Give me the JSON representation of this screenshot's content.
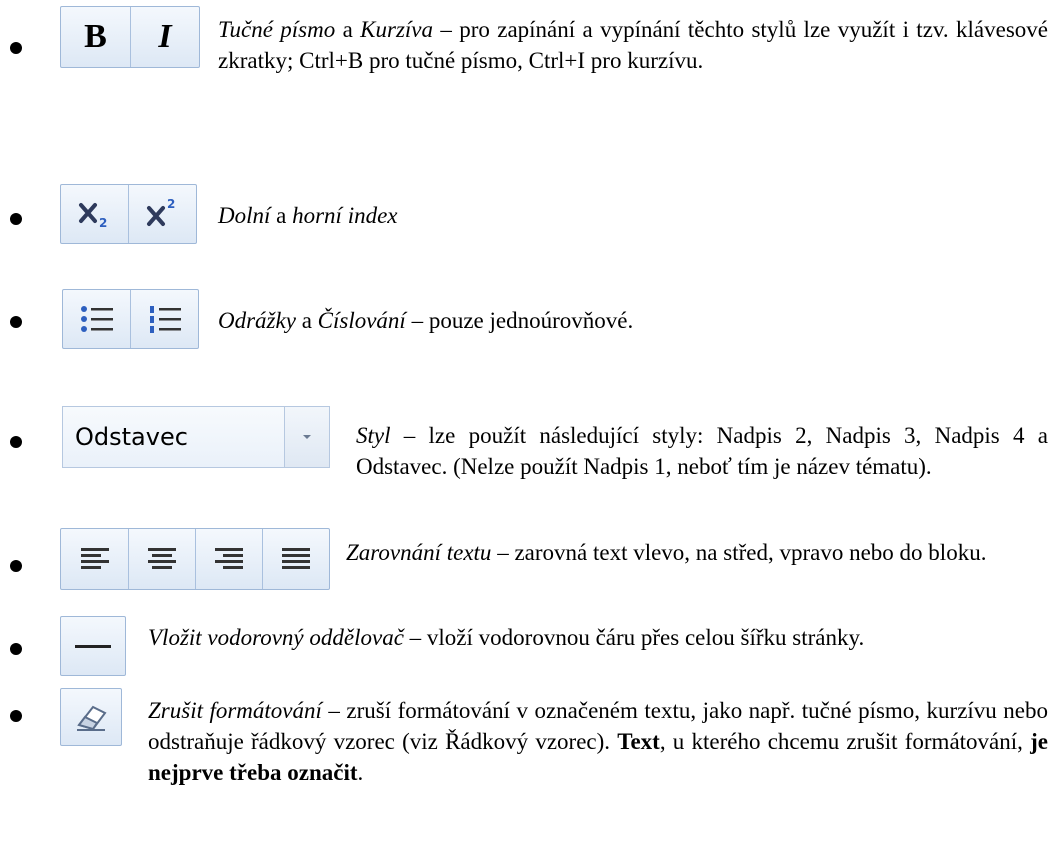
{
  "items": [
    {
      "icons": [
        "bold-button",
        "italic-button"
      ],
      "bold_glyph": "B",
      "italic_glyph": "I",
      "text": [
        {
          "t": "Tučné písmo",
          "s": "i"
        },
        {
          "t": " a "
        },
        {
          "t": "Kurzíva",
          "s": "i"
        },
        {
          "t": " – pro zapínání a vypínání těchto stylů lze využít i tzv. klávesové zkratky; Ctrl+B pro tučné písmo, Ctrl+I pro kurzívu."
        }
      ]
    },
    {
      "icons": [
        "subscript-button",
        "superscript-button"
      ],
      "text": [
        {
          "t": "Dolní",
          "s": "i"
        },
        {
          "t": " a "
        },
        {
          "t": "horní index",
          "s": "i"
        }
      ]
    },
    {
      "icons": [
        "bullets-button",
        "numbering-button"
      ],
      "text": [
        {
          "t": "Odrážky",
          "s": "i"
        },
        {
          "t": " a "
        },
        {
          "t": "Číslování",
          "s": "i"
        },
        {
          "t": " – pouze jednoúrovňové."
        }
      ]
    },
    {
      "icons": [
        "style-select"
      ],
      "style_value": "Odstavec",
      "text": [
        {
          "t": "Styl",
          "s": "i"
        },
        {
          "t": " – lze použít následující styly: Nadpis 2, Nadpis 3, Nadpis 4 a Odstavec. (Nelze použít Nadpis 1, neboť tím je název tématu)."
        }
      ]
    },
    {
      "icons": [
        "align-left-button",
        "align-center-button",
        "align-right-button",
        "align-justify-button"
      ],
      "text": [
        {
          "t": "Zarovnání textu",
          "s": "i"
        },
        {
          "t": " – zarovná text vlevo, na střed, vpravo nebo do bloku."
        }
      ]
    },
    {
      "icons": [
        "horizontal-rule-button"
      ],
      "text": [
        {
          "t": "Vložit vodorovný oddělovač",
          "s": "i"
        },
        {
          "t": " – vloží vodorovnou čáru přes celou šířku stránky."
        }
      ]
    },
    {
      "icons": [
        "clear-formatting-button"
      ],
      "text": [
        {
          "t": "Zrušit formátování",
          "s": "i"
        },
        {
          "t": " – zruší formátování v označeném textu, jako např. tučné písmo, kurzívu nebo odstraňuje řádkový vzorec (viz Řádkový vzorec). "
        },
        {
          "t": "Text",
          "s": "b"
        },
        {
          "t": ", u kterého chcemu zrušit formátování, "
        },
        {
          "t": "je nejprve třeba označit",
          "s": "b"
        },
        {
          "t": "."
        }
      ]
    }
  ]
}
